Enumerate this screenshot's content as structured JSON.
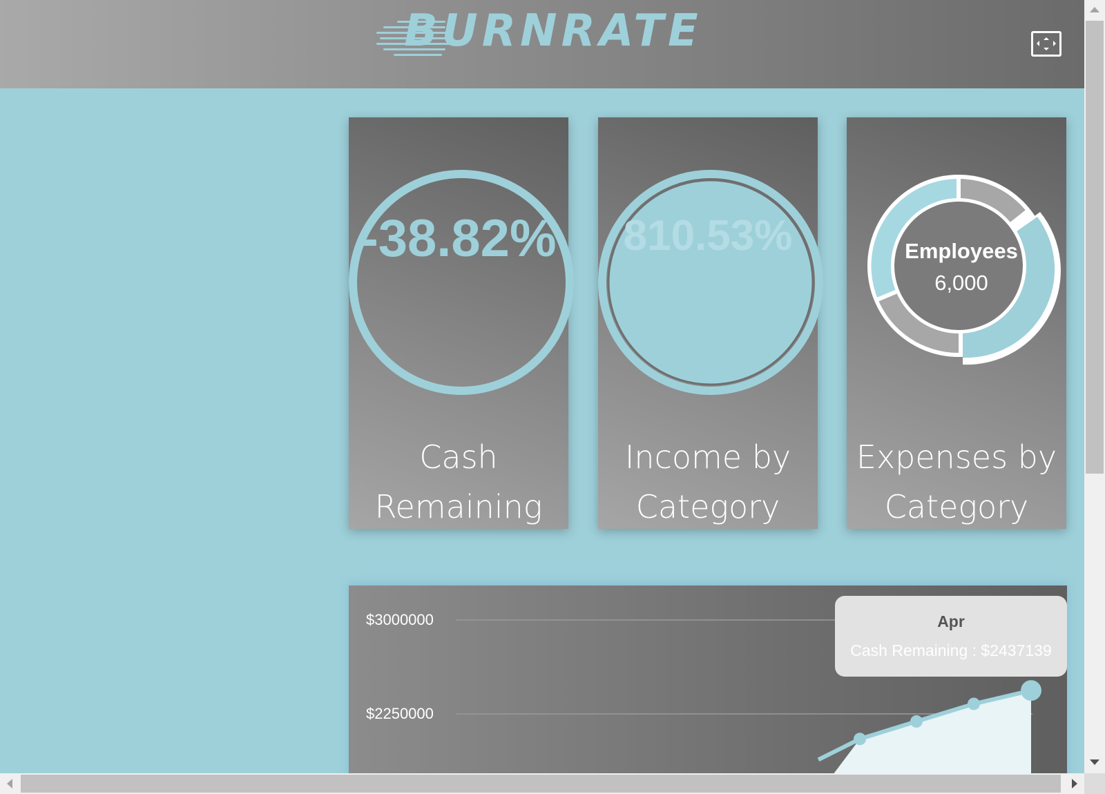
{
  "app": {
    "logo_text": "BURNRATE",
    "fullscreen_icon": "fullscreen-icon"
  },
  "colors": {
    "accent": "#9ed0da",
    "header_dark": "#6b6b6b",
    "card_dark": "#5f5f5f"
  },
  "cards": {
    "cash": {
      "value": "-38.82%",
      "title_line1": "Cash",
      "title_line2": "Remaining"
    },
    "income": {
      "value": "810.53%",
      "title_line1": "Income by",
      "title_line2": "Category"
    },
    "expenses": {
      "center_title": "Employees",
      "center_value": "6,000",
      "title_line1": "Expenses by",
      "title_line2": "Category"
    }
  },
  "tooltip": {
    "month": "Apr",
    "text": "Cash Remaining : $2437139"
  },
  "chart_data": {
    "type": "area",
    "series": [
      {
        "values": [
          2050000,
          2190000,
          2330000,
          2437139
        ]
      }
    ],
    "ytick_labels": [
      "$3000000",
      "$2250000"
    ],
    "ytick_values": [
      3000000,
      2250000
    ],
    "last_category": "Apr",
    "grid": true,
    "legend": "none"
  }
}
